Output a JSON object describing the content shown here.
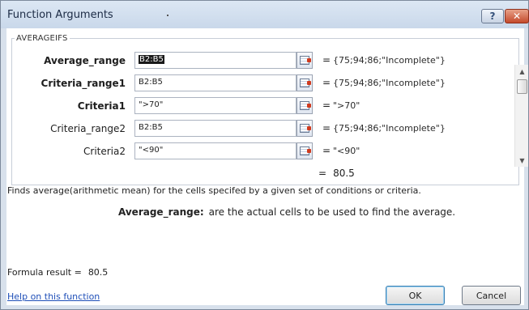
{
  "window": {
    "title": "Function Arguments",
    "help_button": "?",
    "close_button": "✕"
  },
  "function": {
    "name": "AVERAGEIFS"
  },
  "arguments": [
    {
      "label": "Average_range",
      "bold": true,
      "input": "B2:B5",
      "value": "{75;94;86;\"Incomplete\"}"
    },
    {
      "label": "Criteria_range1",
      "bold": true,
      "input": "B2:B5",
      "value": "{75;94;86;\"Incomplete\"}"
    },
    {
      "label": "Criteria1",
      "bold": true,
      "input": "\">70\"",
      "value": "\">70\""
    },
    {
      "label": "Criteria_range2",
      "bold": false,
      "input": "B2:B5",
      "value": "{75;94;86;\"Incomplete\"}"
    },
    {
      "label": "Criteria2",
      "bold": false,
      "input": "\"<90\"",
      "value": "\"<90\""
    }
  ],
  "equals_sign": "=",
  "result_value": "80.5",
  "description": "Finds average(arithmetic mean) for the cells specifed by a given set of conditions or criteria.",
  "argument_help": {
    "name": "Average_range:",
    "text": "are the actual cells to be used to find the average."
  },
  "formula_result": {
    "label": "Formula result =",
    "value": "80.5"
  },
  "help_link": "Help on this function",
  "buttons": {
    "ok": "OK",
    "cancel": "Cancel"
  },
  "icons": {
    "ref": "range-select-icon",
    "scroll_up": "▲",
    "scroll_down": "▼"
  }
}
